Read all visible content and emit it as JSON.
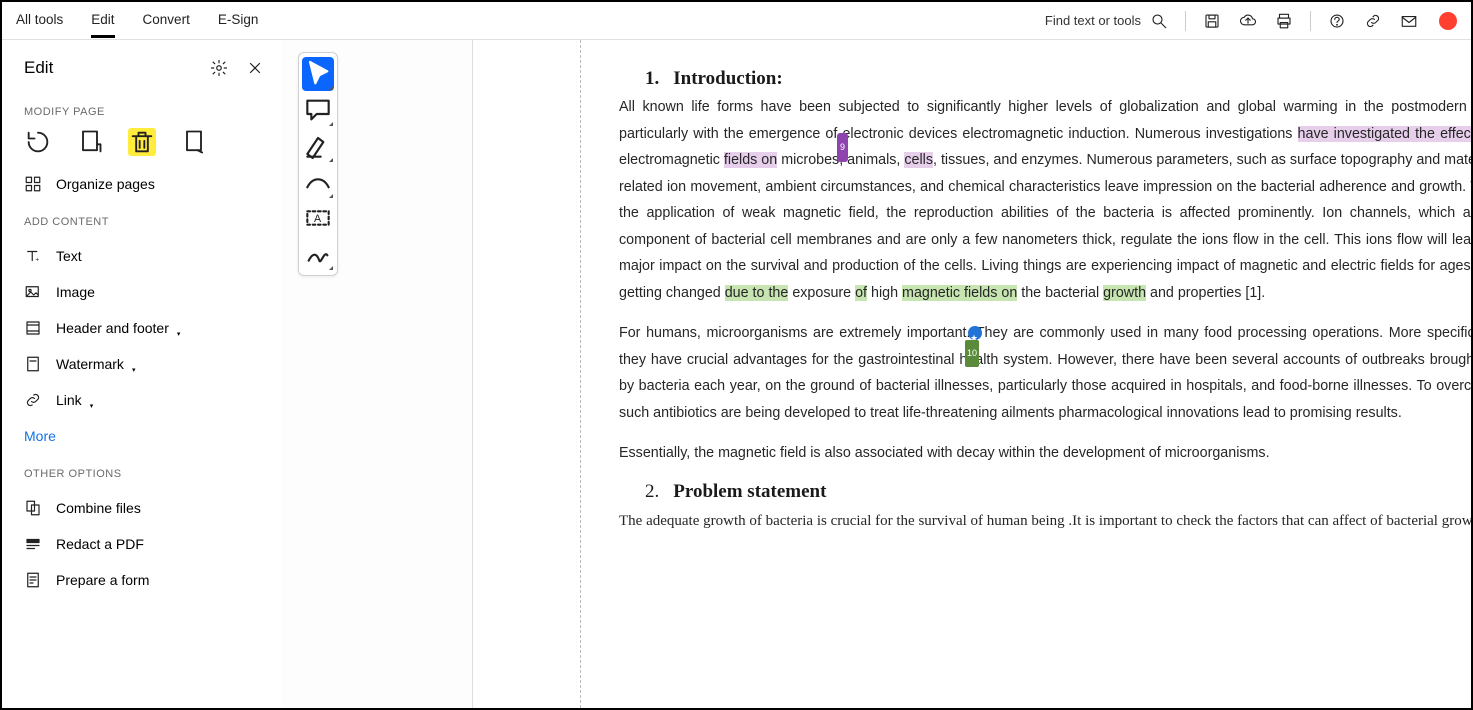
{
  "top_menu": {
    "all_tools": "All tools",
    "edit": "Edit",
    "convert": "Convert",
    "esign": "E-Sign",
    "search_placeholder": "Find text or tools"
  },
  "sidebar": {
    "title": "Edit",
    "section_modify": "MODIFY PAGE",
    "organize": "Organize pages",
    "section_add": "ADD CONTENT",
    "text": "Text",
    "image": "Image",
    "header_footer": "Header and footer",
    "watermark": "Watermark",
    "link": "Link",
    "more": "More",
    "section_other": "OTHER OPTIONS",
    "combine": "Combine files",
    "redact": "Redact a PDF",
    "prepare": "Prepare a form"
  },
  "document": {
    "h1_num": "1.",
    "h1_title": "Introduction:",
    "p1_a": "All known life forms have been subjected to significantly higher levels of globalization and global warming in the postmodern era, particularly with the emergence of electronic devices electromagnetic induction. Numerous investigations ",
    "p1_hl1": "have investigated the effects of",
    "p1_b": " electromagnetic ",
    "p1_hl2": "fields on",
    "p1_c": " microbes, animals, ",
    "p1_hl3": "cells",
    "p1_d": ", tissues, and enzymes. Numerous parameters, such as surface topography and material, related ion movement, ambient circumstances, and chemical characteristics leave impression on the bacterial adherence and growth. With the application of weak magnetic field, the reproduction abilities of the bacteria is affected prominently. Ion channels, which are a component of bacterial cell membranes and are only a few nanometers thick, regulate the ions flow in the cell. This ions flow will leave a major impact on the survival and production of the cells. Living things are experiencing impact of magnetic and electric fields for ages and getting changed ",
    "p1_hl4": "due to the",
    "p1_e": " exposure ",
    "p1_hl5": "of",
    "p1_f": " high ",
    "p1_hl6": "magnetic fields on",
    "p1_g": " the bacterial ",
    "p1_hl7": "growth",
    "p1_h": " and properties [1].",
    "p2": "For humans, microorganisms are extremely important. They are commonly used in many food processing operations. More specifically, they have crucial advantages for the gastrointestinal health system. However, there have been several accounts of outbreaks brought on by bacteria each year, on the ground of bacterial illnesses, particularly those acquired in hospitals, and food-borne illnesses. To overcome such antibiotics are being developed to treat life-threatening ailments pharmacological innovations lead to promising results.",
    "p3": "Essentially, the magnetic field is also associated with decay within the development of microorganisms.",
    "h2_num": "2.",
    "h2_title": "Problem statement",
    "p4": "The adequate growth of bacteria is crucial for the survival of human being .It is important to check the factors that can affect of bacterial growth.",
    "badge9": "9",
    "tag10": "10"
  }
}
